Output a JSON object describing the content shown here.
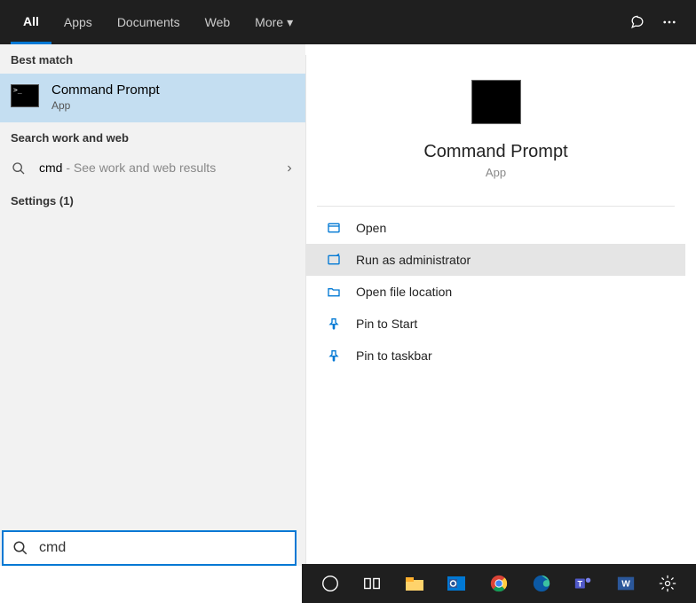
{
  "tabs": {
    "all": "All",
    "apps": "Apps",
    "documents": "Documents",
    "web": "Web",
    "more": "More"
  },
  "sections": {
    "best_match": "Best match",
    "search_web": "Search work and web",
    "settings": "Settings (1)"
  },
  "best_match": {
    "title": "Command Prompt",
    "subtitle": "App"
  },
  "search_row": {
    "query": "cmd",
    "hint": " - See work and web results"
  },
  "preview": {
    "title": "Command Prompt",
    "subtitle": "App"
  },
  "actions": {
    "open": "Open",
    "run_admin": "Run as administrator",
    "open_location": "Open file location",
    "pin_start": "Pin to Start",
    "pin_taskbar": "Pin to taskbar"
  },
  "search_input": {
    "value": "cmd"
  }
}
